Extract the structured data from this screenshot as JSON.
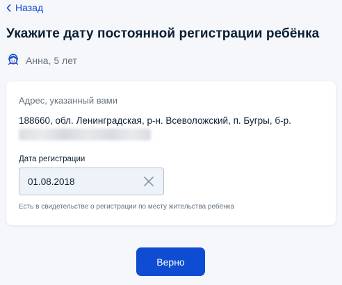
{
  "nav": {
    "back_label": "Назад"
  },
  "header": {
    "title": "Укажите дату постоянной регистрации ребёнка"
  },
  "child": {
    "name": "Анна, 5 лет",
    "icon": "child-face-icon"
  },
  "address": {
    "label": "Адрес, указанный вами",
    "value": "188660, обл. Ленинградская, р-н. Всеволожский, п. Бугры, б-р."
  },
  "registration_date": {
    "label": "Дата регистрации",
    "value": "01.08.2018",
    "hint": "Есть в свидетельстве о регистрации по месту жительства ребёнка"
  },
  "actions": {
    "confirm_label": "Верно"
  },
  "colors": {
    "accent": "#0d4cd3",
    "text": "#0b1f33",
    "muted": "#66727f",
    "background": "#f5f7fa"
  }
}
